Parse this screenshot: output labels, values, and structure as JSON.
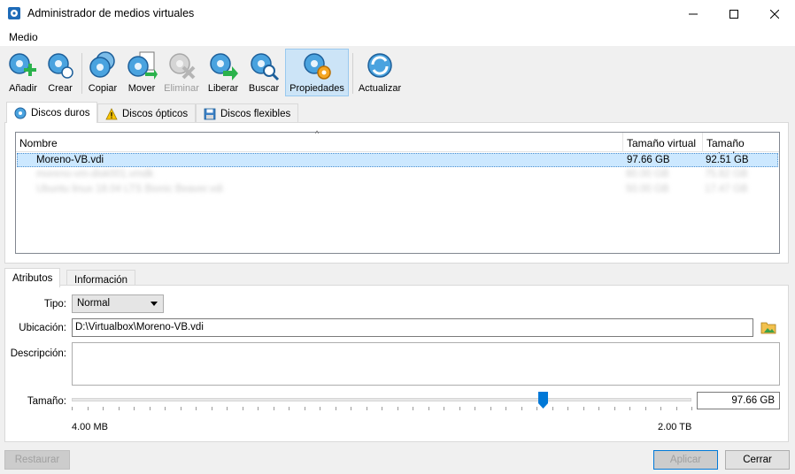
{
  "window": {
    "title": "Administrador de medios virtuales"
  },
  "menu": {
    "items": [
      "Medio"
    ]
  },
  "toolbar": {
    "buttons": [
      {
        "label": "Añadir",
        "icon": "disk-add-icon",
        "enabled": true
      },
      {
        "label": "Crear",
        "icon": "disk-create-icon",
        "enabled": true
      },
      {
        "label": "Copiar",
        "icon": "disk-copy-icon",
        "enabled": true
      },
      {
        "label": "Mover",
        "icon": "disk-move-icon",
        "enabled": true
      },
      {
        "label": "Eliminar",
        "icon": "disk-remove-icon",
        "enabled": false
      },
      {
        "label": "Liberar",
        "icon": "disk-release-icon",
        "enabled": true
      },
      {
        "label": "Buscar",
        "icon": "disk-search-icon",
        "enabled": true
      },
      {
        "label": "Propiedades",
        "icon": "disk-properties-icon",
        "enabled": true,
        "active": true
      },
      {
        "label": "Actualizar",
        "icon": "refresh-icon",
        "enabled": true
      }
    ]
  },
  "media_tabs": [
    {
      "label": "Discos duros",
      "icon": "hard-disk-icon",
      "selected": true
    },
    {
      "label": "Discos ópticos",
      "icon": "warning-icon",
      "selected": false
    },
    {
      "label": "Discos flexibles",
      "icon": "floppy-disk-icon",
      "selected": false
    }
  ],
  "media_list": {
    "columns": [
      "Nombre",
      "Tamaño virtual",
      "Tamaño actual"
    ],
    "sort_indicator": "^",
    "rows": [
      {
        "name": "Moreno-VB.vdi",
        "virtual": "97.66 GB",
        "actual": "92.51 GB",
        "selected": true,
        "blurred": false
      },
      {
        "name": "moreno-vm-disk001.vmdk",
        "virtual": "80.00 GB",
        "actual": "75.82 GB",
        "selected": false,
        "blurred": true
      },
      {
        "name": "Ubuntu linux 18.04 LTS Bionic Beaver.vdi",
        "virtual": "50.00 GB",
        "actual": "17.47 GB",
        "selected": false,
        "blurred": true
      }
    ]
  },
  "detail_tabs": [
    {
      "label": "Atributos",
      "selected": true
    },
    {
      "label": "Información",
      "selected": false
    }
  ],
  "attributes": {
    "type_label": "Tipo:",
    "type_value": "Normal",
    "location_label": "Ubicación:",
    "location_value": "D:\\Virtualbox\\Moreno-VB.vdi",
    "description_label": "Descripción:",
    "description_value": "",
    "size_label": "Tamaño:",
    "size_value": "97.66 GB",
    "size_min_label": "4.00 MB",
    "size_max_label": "2.00 TB",
    "size_slider_fraction": 0.76
  },
  "buttons": {
    "restore": "Restaurar",
    "apply": "Aplicar",
    "close": "Cerrar"
  },
  "colors": {
    "selection": "#cce8ff",
    "accent": "#0078d7",
    "toolbar_active": "#cce4f7"
  }
}
